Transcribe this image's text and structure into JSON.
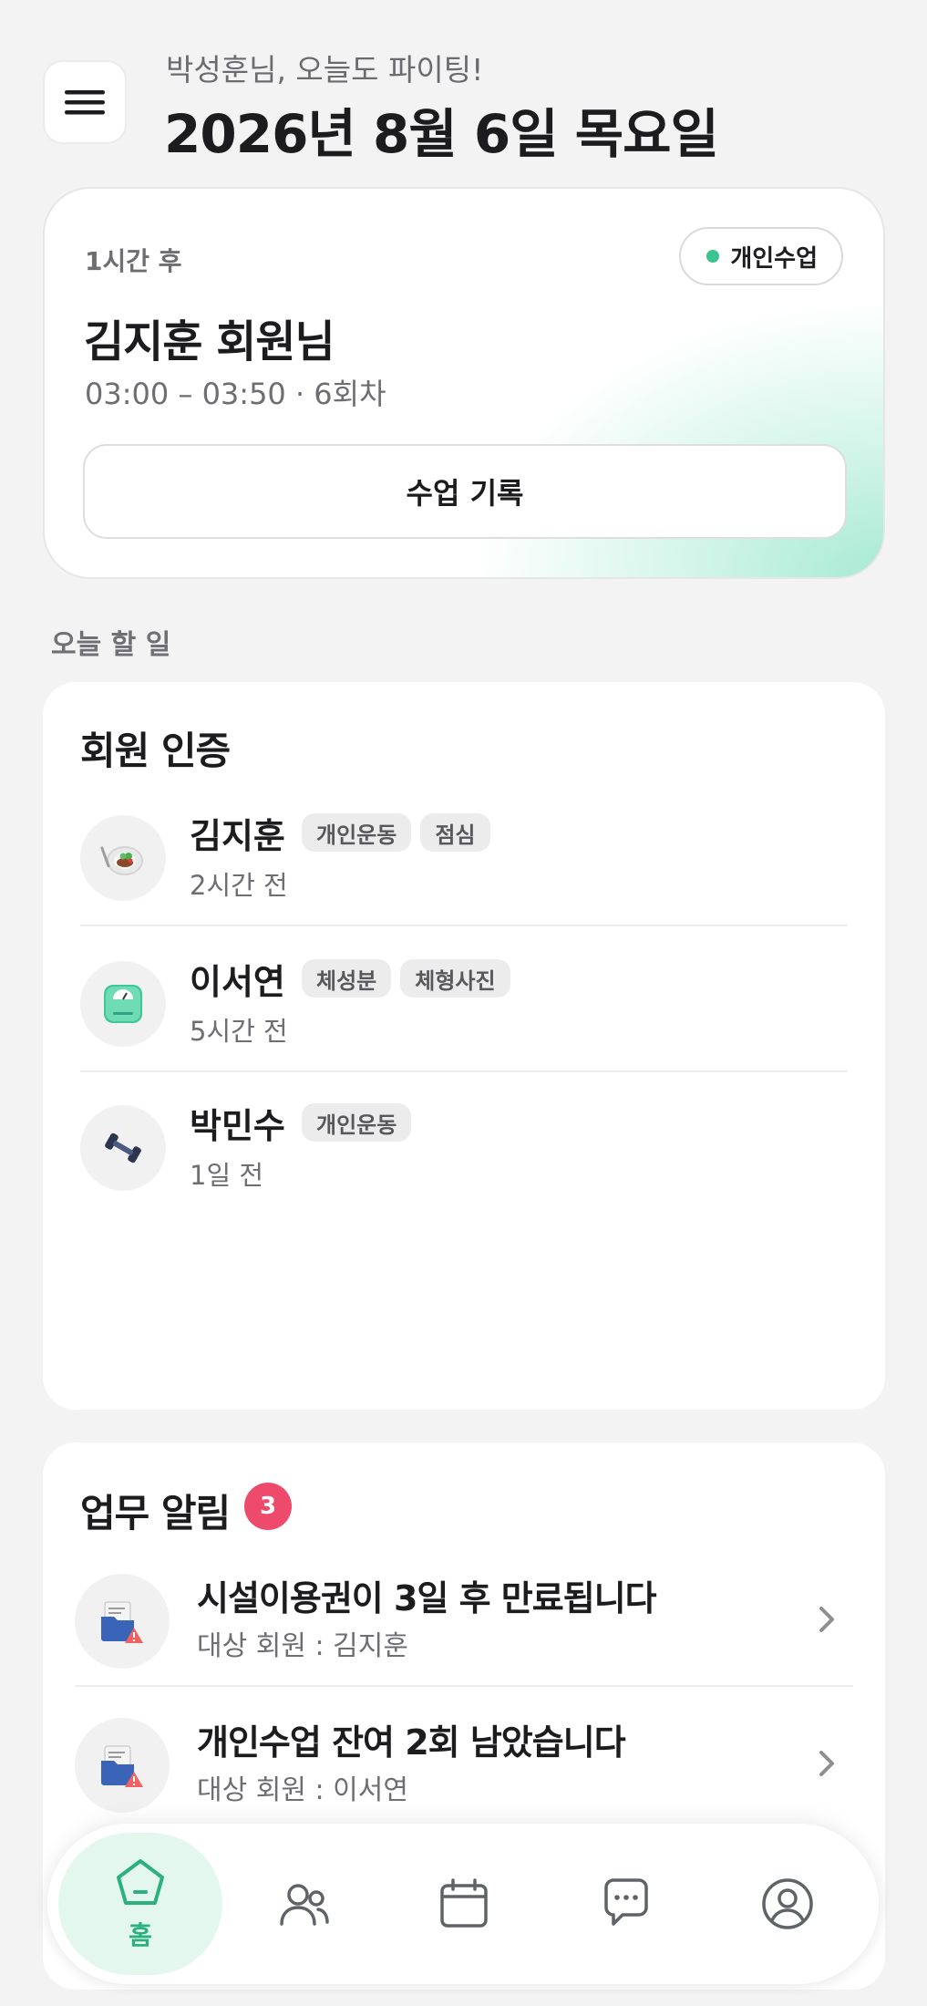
{
  "header": {
    "greeting": "박성훈님, 오늘도 파이팅!",
    "date": "2026년 8월 6일 목요일",
    "menu_icon": "hamburger-icon"
  },
  "next_class": {
    "time_until": "1시간 후",
    "type_badge": "개인수업",
    "member": "김지훈 회원님",
    "session": "03:00 – 03:50 · 6회차",
    "record_button": "수업 기록",
    "accent_color": "#3cc48e"
  },
  "todo_label": "오늘 할 일",
  "verification": {
    "title": "회원 인증",
    "items": [
      {
        "name": "김지훈",
        "tags": [
          "개인운동",
          "점심"
        ],
        "time": "2시간 전",
        "icon": "meal-plate-icon"
      },
      {
        "name": "이서연",
        "tags": [
          "체성분",
          "체형사진"
        ],
        "time": "5시간 전",
        "icon": "scale-icon"
      },
      {
        "name": "박민수",
        "tags": [
          "개인운동"
        ],
        "time": "1일 전",
        "icon": "dumbbell-icon"
      }
    ]
  },
  "alerts": {
    "title": "업무 알림",
    "count": "3",
    "badge_color": "#ee4a6c",
    "items": [
      {
        "text": "시설이용권이 3일 후 만료됩니다",
        "sub": "대상 회원 : 김지훈",
        "icon": "folder-warning-icon"
      },
      {
        "text": "개인수업 잔여 2회 남았습니다",
        "sub": "대상 회원 : 이서연",
        "icon": "folder-warning-icon"
      }
    ]
  },
  "nav": {
    "home_label": "홈",
    "items": [
      "home-icon",
      "members-icon",
      "calendar-icon",
      "chat-icon",
      "profile-icon"
    ]
  }
}
